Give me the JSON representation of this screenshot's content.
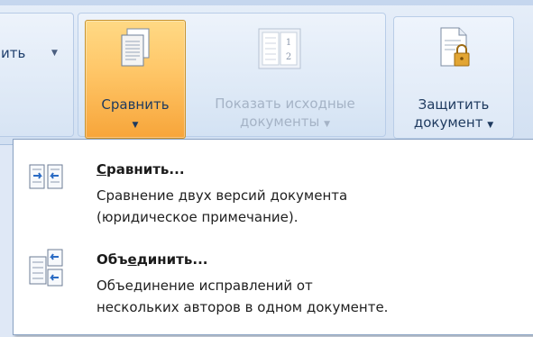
{
  "ribbon": {
    "left_partial_label": "ить",
    "compare_button": {
      "label": "Сравнить",
      "icon": "compare-documents-icon"
    },
    "show_source_button": {
      "label_line1": "Показать исходные",
      "label_line2": "документы",
      "icon": "source-documents-icon"
    },
    "protect_button": {
      "label_line1": "Защитить",
      "label_line2": "документ",
      "icon": "protect-document-icon"
    },
    "colors": {
      "highlight": "#ffc86a",
      "text": "#1e3a5f",
      "disabled_text": "#a5b3c6"
    }
  },
  "menu": {
    "items": [
      {
        "title_acc": "С",
        "title_rest": "равнить...",
        "desc_line1": "Сравнение двух версий документа",
        "desc_line2": "(юридическое примечание).",
        "icon": "compare-icon"
      },
      {
        "title_pre": "Объ",
        "title_acc": "е",
        "title_rest": "динить...",
        "desc_line1": "Объединение исправлений от",
        "desc_line2": "нескольких авторов в одном документе.",
        "icon": "merge-icon"
      }
    ]
  }
}
